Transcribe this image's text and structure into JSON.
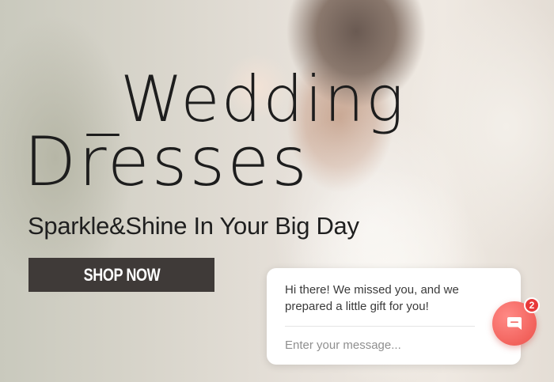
{
  "hero": {
    "title_line1": "_Wedding",
    "title_line2": "Dresses",
    "tagline": "Sparkle&Shine In Your Big Day",
    "cta_label": "SHOP NOW"
  },
  "chat": {
    "message": "Hi there! We missed you, and we prepared a little gift for you!",
    "input_placeholder": "Enter your message...",
    "unread_count": "2",
    "launcher_icon": "chat-bubble-icon",
    "accent_color": "#f2625c",
    "badge_color": "#e8393a"
  }
}
